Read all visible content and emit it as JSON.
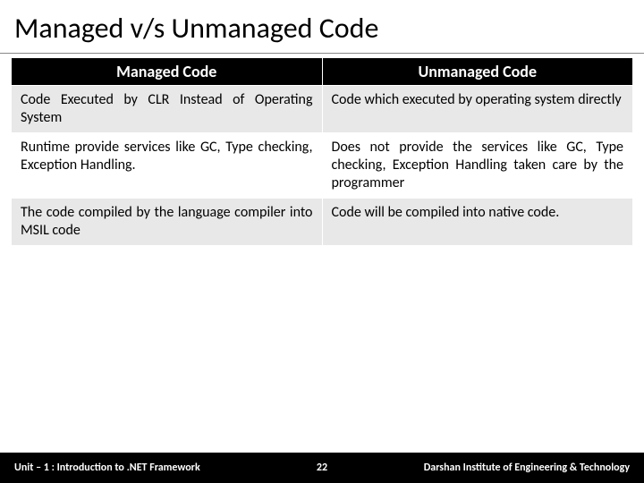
{
  "title": "Managed v/s Unmanaged Code",
  "headers": [
    "Managed Code",
    "Unmanaged Code"
  ],
  "rows": [
    {
      "left": "Code Executed by CLR Instead of Operating System",
      "right": "Code which executed by operating system directly"
    },
    {
      "left": "Runtime provide services like GC, Type checking, Exception Handling.",
      "right": "Does not provide the services like GC, Type checking, Exception Handling taken care by the programmer"
    },
    {
      "left": "The code compiled by the language compiler into MSIL code",
      "right": "Code will be compiled into native code."
    }
  ],
  "footer": {
    "left": "Unit – 1 : Introduction to .NET Framework",
    "center": "22",
    "right": "Darshan Institute of Engineering & Technology"
  }
}
